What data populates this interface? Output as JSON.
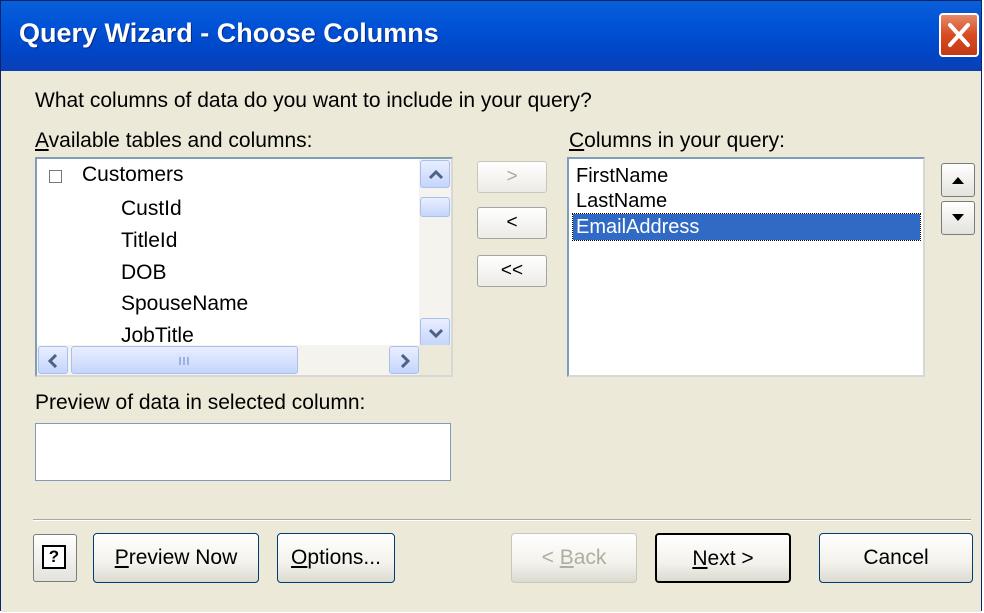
{
  "window": {
    "title": "Query Wizard - Choose Columns"
  },
  "prompt": "What columns of data do you want to include in your query?",
  "available": {
    "label_pre": "",
    "label_accel": "A",
    "label_post": "vailable tables and columns:",
    "table": "Customers",
    "columns": [
      "CustId",
      "TitleId",
      "DOB",
      "SpouseName",
      "JobTitle"
    ]
  },
  "movers": {
    "add": ">",
    "remove": "<",
    "remove_all": "<<"
  },
  "query": {
    "label_accel": "C",
    "label_post": "olumns in your query:",
    "items": [
      "FirstName",
      "LastName",
      "EmailAddress"
    ],
    "selected_index": 2
  },
  "preview": {
    "label": "Preview of data in selected column:",
    "value": ""
  },
  "buttons": {
    "help": "?",
    "preview_now_accel": "P",
    "preview_now_post": "review Now",
    "options_accel": "O",
    "options_post": "ptions...",
    "back_pre": "< ",
    "back_accel": "B",
    "back_post": "ack",
    "next_accel": "N",
    "next_post": "ext >",
    "cancel": "Cancel"
  },
  "colors": {
    "titlebar": "#0052d6",
    "dialog_bg": "#ece9d8",
    "selection": "#316ac5",
    "close": "#d84a22"
  },
  "icons": {
    "close": "close-icon",
    "scroll_up": "chevron-up-icon",
    "scroll_down": "chevron-down-icon",
    "scroll_left": "chevron-left-icon",
    "scroll_right": "chevron-right-icon",
    "move_up": "triangle-up-icon",
    "move_down": "triangle-down-icon",
    "help": "help-icon"
  }
}
